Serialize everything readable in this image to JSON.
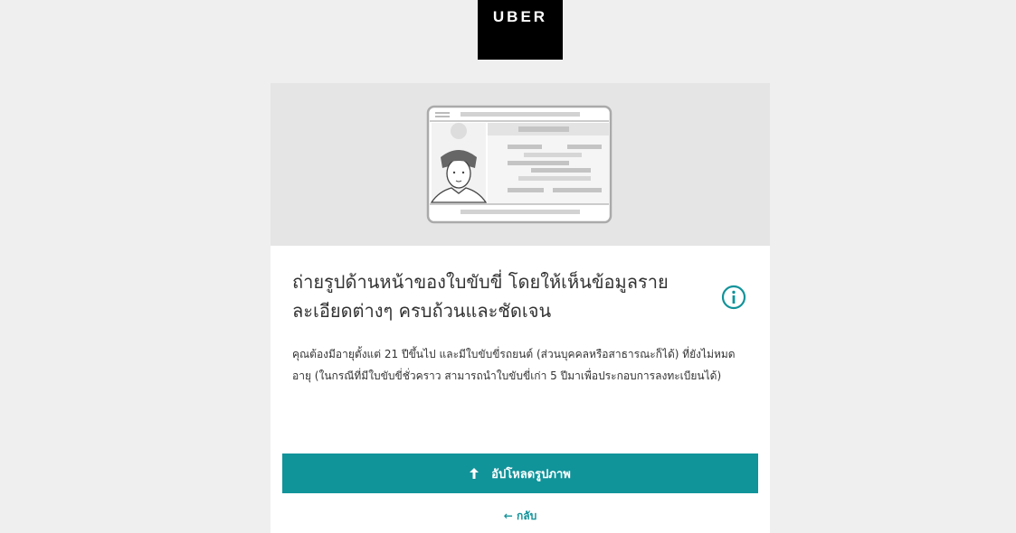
{
  "header": {
    "logo_text": "UBER"
  },
  "card": {
    "illustration": "driver-license-front-icon",
    "title": "ถ่ายรูปด้านหน้าของใบขับขี่ โดยให้เห็นข้อมูลรายละเอียดต่างๆ ครบถ้วนและชัดเจน",
    "info_icon": "info-icon",
    "description": "คุณต้องมีอายุตั้งแต่ 21 ปีขึ้นไป และมีใบขับขี่รถยนต์ (ส่วนบุคคลหรือสาธารณะก็ได้) ที่ยังไม่หมดอายุ (ในกรณีที่มีใบขับขี่ชั่วคราว สามารถนำใบขับขี่เก่า 5 ปีมาเพื่อประกอบการลงทะเบียนได้)",
    "upload_button_label": "อัปโหลดรูปภาพ",
    "upload_icon": "upload-icon",
    "back_label": "← กลับ"
  },
  "colors": {
    "accent": "#11939a",
    "page_background": "#efefef",
    "hero_background": "#e5e5e5",
    "logo_background": "#000000"
  }
}
